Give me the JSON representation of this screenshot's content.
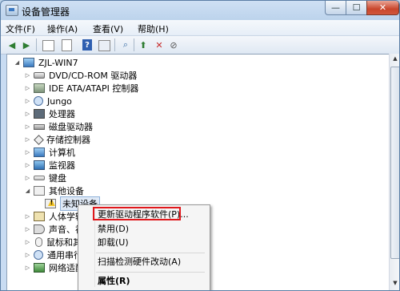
{
  "window": {
    "title": "设备管理器",
    "controls": {
      "min": "—",
      "max": "☐",
      "close": "✕"
    }
  },
  "menu": [
    "文件(F)",
    "操作(A)",
    "查看(V)",
    "帮助(H)"
  ],
  "toolbar": {
    "icons": [
      "back-icon",
      "forward-icon",
      "console-tree-icon",
      "properties-icon",
      "help-icon",
      "view-icon",
      "scan-hardware-icon",
      "update-driver-icon",
      "uninstall-icon",
      "disable-icon"
    ]
  },
  "tree": {
    "root": "ZJL-WIN7",
    "items": [
      "DVD/CD-ROM 驱动器",
      "IDE ATA/ATAPI 控制器",
      "Jungo",
      "处理器",
      "磁盘驱动器",
      "存储控制器",
      "计算机",
      "监视器",
      "键盘",
      "其他设备",
      "未知设备",
      "人体学输",
      "声音、视",
      "鼠标和其",
      "通用串行",
      "网络适配"
    ]
  },
  "context_menu": {
    "items": [
      "更新驱动程序软件(P)...",
      "禁用(D)",
      "卸载(U)",
      "扫描检测硬件改动(A)",
      "属性(R)"
    ]
  },
  "colors": {
    "highlight_box": "#e0181c"
  }
}
